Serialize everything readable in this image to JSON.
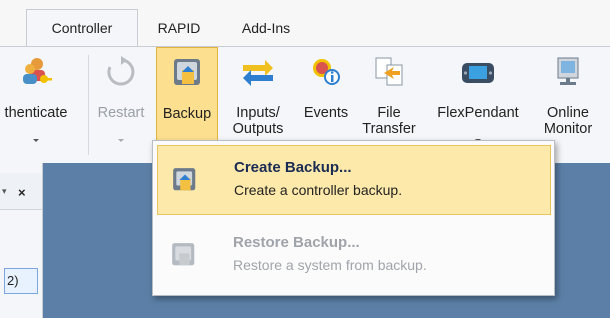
{
  "tabs": [
    {
      "label": "Controller",
      "active": true
    },
    {
      "label": "RAPID",
      "active": false
    },
    {
      "label": "Add-Ins",
      "active": false
    }
  ],
  "ribbon": {
    "authenticate": {
      "label": "thenticate",
      "icon": "users-key-icon"
    },
    "restart": {
      "label": "Restart",
      "icon": "restart-icon",
      "disabled": true
    },
    "backup": {
      "label": "Backup",
      "icon": "backup-icon",
      "pressed": true
    },
    "inputs_outputs": {
      "line1": "Inputs/",
      "line2": "Outputs",
      "icon": "io-arrows-icon"
    },
    "events": {
      "label": "Events",
      "icon": "events-icon"
    },
    "file_transfer": {
      "line1": "File",
      "line2": "Transfer",
      "icon": "file-transfer-icon"
    },
    "flexpendant": {
      "label": "FlexPendant",
      "icon": "flexpendant-icon"
    },
    "online_monitor": {
      "line1": "Online",
      "line2": "Monitor",
      "icon": "monitor-icon"
    }
  },
  "left_pane": {
    "close": "×",
    "item": "2)"
  },
  "menu": {
    "items": [
      {
        "title": "Create Backup...",
        "desc": "Create a controller backup.",
        "highlighted": true,
        "enabled": true,
        "icon": "backup-icon"
      },
      {
        "title": "Restore Backup...",
        "desc": "Restore a system from backup.",
        "highlighted": false,
        "enabled": false,
        "icon": "restore-icon"
      }
    ]
  },
  "colors": {
    "accent_highlight": "#fde9a9",
    "workarea": "#5b7fa6",
    "ribbon_bg": "#f4f6f9"
  }
}
